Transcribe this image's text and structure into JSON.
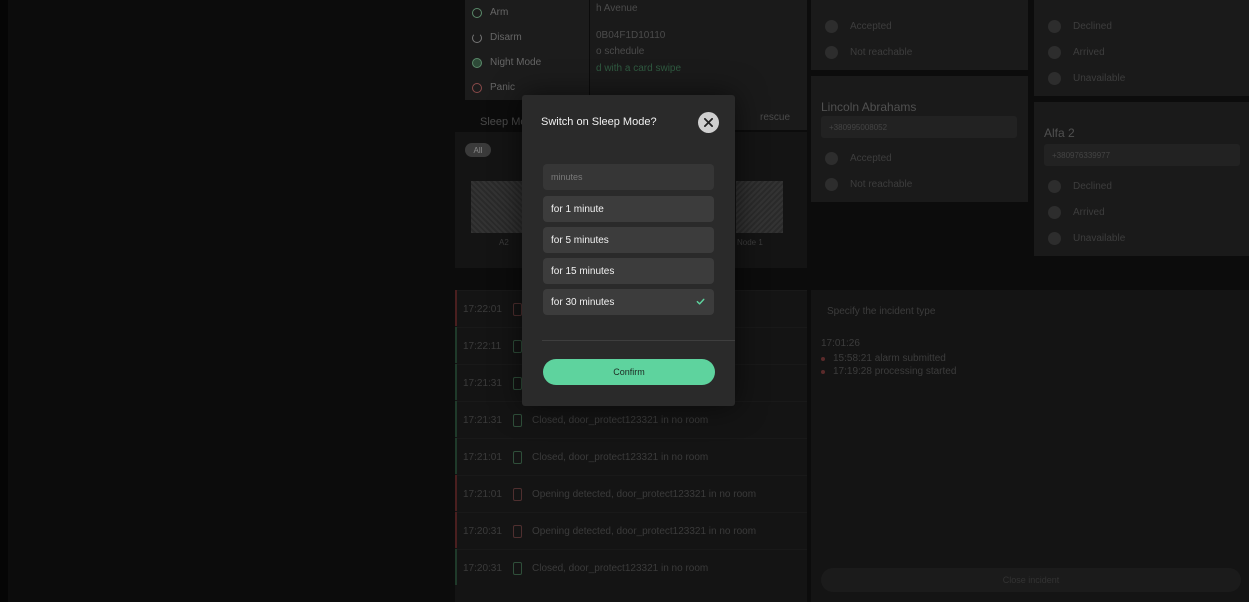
{
  "menu": {
    "items": [
      {
        "label": "Arm",
        "color": "#5a8a6a"
      },
      {
        "label": "Disarm",
        "color": "#777777"
      },
      {
        "label": "Night Mode",
        "color": "#5a8a6a"
      },
      {
        "label": "Panic",
        "color": "#8a4a4a"
      }
    ]
  },
  "background": {
    "address_fragment": "h Avenue",
    "device_id": "0B04F1D10110",
    "schedule": "o schedule",
    "hint": "d with a card swipe",
    "sleep_mode_label": "Sleep Mo",
    "all_tab": "All",
    "camera_label_left": "A2",
    "camera_label_right": "Node 1",
    "rescue_fragment": "rescue",
    "contact_name": "Lincoln Abrahams",
    "contact_phone": "+380995008052",
    "contact_phone_2": "+380976339977",
    "contact2_name": "Alfa 2",
    "status_options": [
      "Accepted",
      "Not reachable"
    ],
    "status_options_right": [
      "Declined",
      "Arrived",
      "Unavailable"
    ],
    "dropdown_placeholder": "Specify the incident type",
    "timeline_time": "17:01:26",
    "timeline_events": [
      "15:58:21 alarm submitted",
      "17:19:28 processing started"
    ],
    "footer_button": "Close incident",
    "events": [
      {
        "time": "17:22:01",
        "text": "",
        "type": "red"
      },
      {
        "time": "17:22:11",
        "text": "",
        "type": "green"
      },
      {
        "time": "17:21:31",
        "text": "",
        "type": "green"
      },
      {
        "time": "17:21:31",
        "text": "Closed, door_protect123321 in no room",
        "type": "green"
      },
      {
        "time": "17:21:01",
        "text": "Closed, door_protect123321 in no room",
        "type": "green"
      },
      {
        "time": "17:21:01",
        "text": "Opening detected, door_protect123321 in no room",
        "type": "red"
      },
      {
        "time": "17:20:31",
        "text": "Opening detected, door_protect123321 in no room",
        "type": "red"
      },
      {
        "time": "17:20:31",
        "text": "Closed, door_protect123321 in no room",
        "type": "green"
      }
    ]
  },
  "modal": {
    "title": "Switch on Sleep Mode?",
    "select_placeholder": "minutes",
    "options": [
      "for 1 minute",
      "for 5 minutes",
      "for 15 minutes",
      "for 30 minutes"
    ],
    "selected_index": 3,
    "confirm_label": "Confirm",
    "accent": "#5ed39e"
  }
}
